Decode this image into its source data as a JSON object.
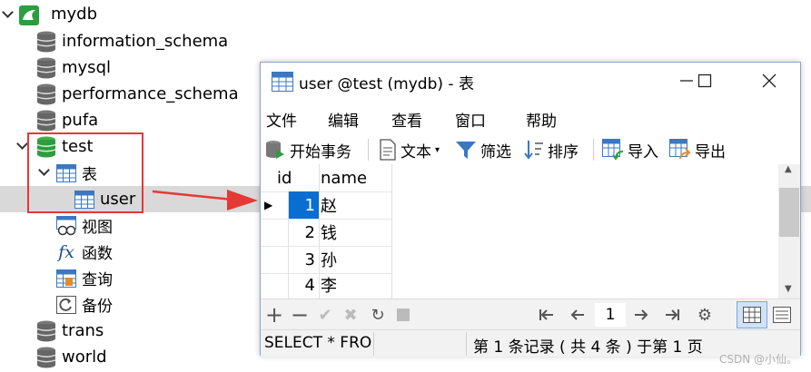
{
  "tree": {
    "connection": "mydb",
    "databases": [
      {
        "name": "information_schema"
      },
      {
        "name": "mysql"
      },
      {
        "name": "performance_schema"
      },
      {
        "name": "pufa"
      },
      {
        "name": "test"
      },
      {
        "name": "trans"
      },
      {
        "name": "world"
      }
    ],
    "test_children": {
      "tables_label": "表",
      "table_user": "user",
      "views_label": "视图",
      "functions_label": "函数",
      "queries_label": "查询",
      "backups_label": "备份"
    }
  },
  "window": {
    "title": "user @test (mydb) - 表",
    "menu": [
      "文件",
      "编辑",
      "查看",
      "窗口",
      "帮助"
    ],
    "toolbar": {
      "begin_transaction": "开始事务",
      "text": "文本",
      "filter": "筛选",
      "sort": "排序",
      "import": "导入",
      "export": "导出"
    },
    "grid": {
      "columns": [
        "id",
        "name"
      ],
      "rows": [
        {
          "id": "1",
          "name": "赵"
        },
        {
          "id": "2",
          "name": "钱"
        },
        {
          "id": "3",
          "name": "孙"
        },
        {
          "id": "4",
          "name": "李"
        }
      ]
    },
    "page_number": "1",
    "status": {
      "sql": "SELECT * FRO",
      "record": "第 1 条记录 ( 共 4 条 ) 于第 1 页"
    }
  },
  "watermark": "CSDN @小仙。",
  "colors": {
    "accent_red": "#e53935",
    "selected_cell": "#0a6ed1",
    "db_icon": "#666666",
    "db_icon_active": "#2e9d3f",
    "table_icon": "#3a78c2"
  }
}
